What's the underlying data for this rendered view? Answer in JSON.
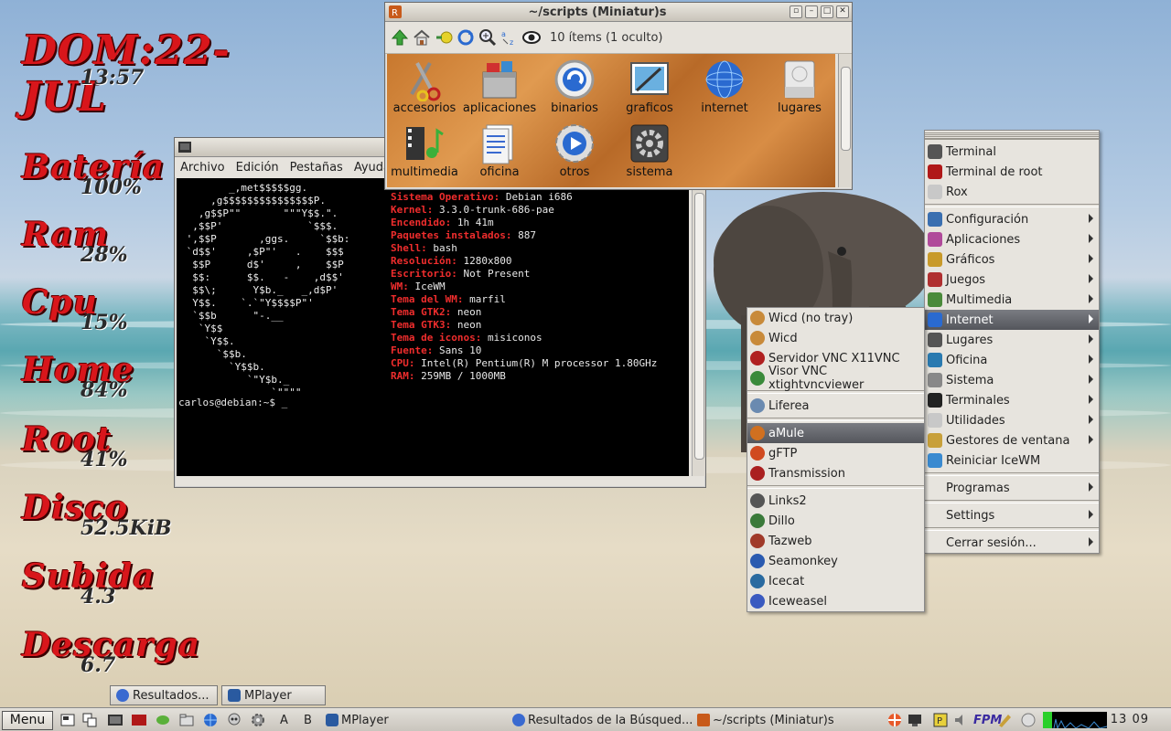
{
  "conky": {
    "date": "DOM:22-JUL",
    "time": "13:57",
    "rows": [
      {
        "label": "Batería",
        "value": "100%"
      },
      {
        "label": "Ram",
        "value": "28%"
      },
      {
        "label": "Cpu",
        "value": "15%"
      },
      {
        "label": "Home",
        "value": "84%"
      },
      {
        "label": "Root",
        "value": "41%"
      },
      {
        "label": "Disco",
        "value": "52.5KiB"
      },
      {
        "label": "Subida",
        "value": "4.3"
      },
      {
        "label": "Descarga",
        "value": "6.7"
      }
    ]
  },
  "terminal": {
    "menu": [
      "Archivo",
      "Edición",
      "Pestañas",
      "Ayuda"
    ],
    "art": [
      "        _,met$$$$$gg.",
      "     ,g$$$$$$$$$$$$$$$P.",
      "   ,g$$P\"\"       \"\"\"Y$$.\".",
      "  ,$$P'              `$$$.",
      " ',$$P       ,ggs.     `$$b:",
      " `d$$'     ,$P\"'   .    $$$",
      "  $$P      d$'     ,    $$P",
      "  $$:      $$.   -    ,d$$'",
      "  $$\\;      Y$b._   _,d$P'",
      "  Y$$.    `.`\"Y$$$$P\"'",
      "  `$$b      \"-.__",
      "   `Y$$",
      "    `Y$$.",
      "      `$$b.",
      "        `Y$$b.",
      "           `\"Y$b._",
      "               `\"\"\"\""
    ],
    "info": [
      {
        "key": "Sistema Operativo:",
        "val": "Debian i686"
      },
      {
        "key": "Kernel:",
        "val": "3.3.0-trunk-686-pae"
      },
      {
        "key": "Encendido:",
        "val": "1h 41m"
      },
      {
        "key": "Paquetes instalados:",
        "val": "887"
      },
      {
        "key": "Shell:",
        "val": "bash"
      },
      {
        "key": "Resolución:",
        "val": "1280x800"
      },
      {
        "key": "Escritorio:",
        "val": "Not Present"
      },
      {
        "key": "WM:",
        "val": "IceWM"
      },
      {
        "key": "Tema del WM:",
        "val": "marfil"
      },
      {
        "key": "Tema GTK2:",
        "val": "neon"
      },
      {
        "key": "Tema GTK3:",
        "val": "neon"
      },
      {
        "key": "Tema de iconos:",
        "val": "misiconos"
      },
      {
        "key": "Fuente:",
        "val": "Sans 10"
      },
      {
        "key": "CPU:",
        "val": "Intel(R) Pentium(R) M processor 1.80GHz"
      },
      {
        "key": "RAM:",
        "val": "259MB / 1000MB"
      }
    ],
    "prompt": "carlos@debian:~$ _"
  },
  "rox": {
    "title": "~/scripts (Miniatur)s",
    "count": "10 ítems (1 oculto)",
    "files": [
      "accesorios",
      "aplicaciones",
      "binarios",
      "graficos",
      "internet",
      "lugares",
      "multimedia",
      "oficina",
      "otros",
      "sistema"
    ]
  },
  "main_menu": {
    "items": [
      {
        "label": "Terminal",
        "arrow": false,
        "color": "#555555"
      },
      {
        "label": "Terminal de root",
        "arrow": false,
        "color": "#b01818"
      },
      {
        "label": "Rox",
        "arrow": false,
        "color": "#c8c8c8"
      },
      {
        "label": "Configuración",
        "arrow": true,
        "color": "#3a6fb0"
      },
      {
        "label": "Aplicaciones",
        "arrow": true,
        "color": "#b04a9a"
      },
      {
        "label": "Gráficos",
        "arrow": true,
        "color": "#c89a2a"
      },
      {
        "label": "Juegos",
        "arrow": true,
        "color": "#b03030"
      },
      {
        "label": "Multimedia",
        "arrow": true,
        "color": "#4a8a3a"
      },
      {
        "label": "Internet",
        "arrow": true,
        "color": "#2a6ad0"
      },
      {
        "label": "Lugares",
        "arrow": true,
        "color": "#555555"
      },
      {
        "label": "Oficina",
        "arrow": true,
        "color": "#2a7ab0"
      },
      {
        "label": "Sistema",
        "arrow": true,
        "color": "#888888"
      },
      {
        "label": "Terminales",
        "arrow": true,
        "color": "#222222"
      },
      {
        "label": "Utilidades",
        "arrow": true,
        "color": "#c8c8c8"
      },
      {
        "label": "Gestores de ventana",
        "arrow": true,
        "color": "#c8a03a"
      },
      {
        "label": "Reiniciar IceWM",
        "arrow": false,
        "color": "#3a8ad0"
      },
      {
        "label": "Programas",
        "arrow": true
      },
      {
        "label": "Settings",
        "arrow": true
      },
      {
        "label": "Cerrar sesión...",
        "arrow": true
      }
    ]
  },
  "internet_menu": {
    "items": [
      {
        "label": "Wicd (no tray)",
        "color": "#c88a3a"
      },
      {
        "label": "Wicd",
        "color": "#c88a3a"
      },
      {
        "label": "Servidor VNC X11VNC",
        "color": "#b02020"
      },
      {
        "label": "Visor VNC xtightvncviewer",
        "color": "#3a8a3a"
      },
      {
        "label": "Liferea",
        "color": "#6a8ab0"
      },
      {
        "label": "aMule",
        "color": "#d07020"
      },
      {
        "label": "gFTP",
        "color": "#d04a20"
      },
      {
        "label": "Transmission",
        "color": "#aa2020"
      },
      {
        "label": "Links2",
        "color": "#555555"
      },
      {
        "label": "Dillo",
        "color": "#3a7a3a"
      },
      {
        "label": "Tazweb",
        "color": "#a03a2a"
      },
      {
        "label": "Seamonkey",
        "color": "#2a5ab0"
      },
      {
        "label": "Icecat",
        "color": "#2a6aa0"
      },
      {
        "label": "Iceweasel",
        "color": "#3a5ac0"
      }
    ]
  },
  "taskbar": {
    "start": "Menu",
    "mini_tasks": [
      "Resultados...",
      "MPlayer"
    ],
    "letter_a": "A",
    "letter_b": "B",
    "tasks": [
      "MPlayer",
      "Resultados de la Búsqued...",
      "~/scripts (Miniatur)s"
    ],
    "fpm": "FPM",
    "clock": "13 09"
  }
}
